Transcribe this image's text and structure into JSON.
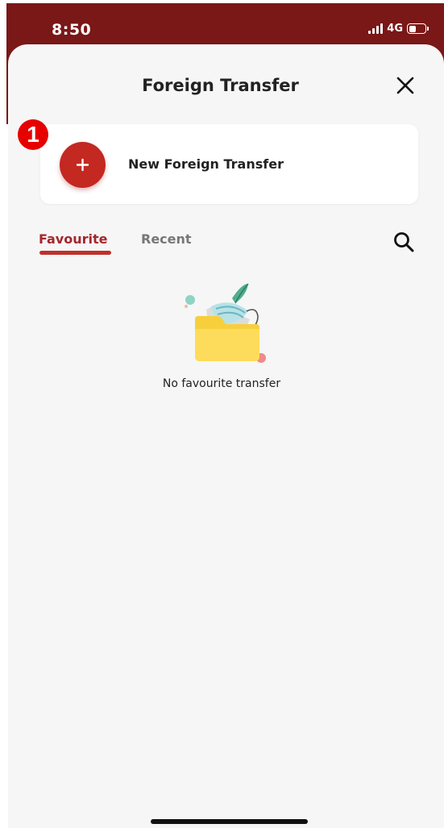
{
  "status_bar": {
    "time": "8:50",
    "network": "4G",
    "battery_level": 0.45
  },
  "header": {
    "title": "Foreign Transfer",
    "close_icon": "close-icon"
  },
  "new_transfer": {
    "label": "New Foreign Transfer",
    "icon": "plus-icon",
    "step_badge": "1"
  },
  "tabs": [
    {
      "label": "Favourite",
      "active": true
    },
    {
      "label": "Recent",
      "active": false
    }
  ],
  "search_icon": "search-icon",
  "empty_state": {
    "message": "No favourite transfer",
    "icon": "empty-folder-illustration"
  },
  "colors": {
    "brand_dark": "#7a1717",
    "accent": "#c32821",
    "active_tab": "#a4262c",
    "badge": "#e60000",
    "background": "#f6f6f6"
  }
}
